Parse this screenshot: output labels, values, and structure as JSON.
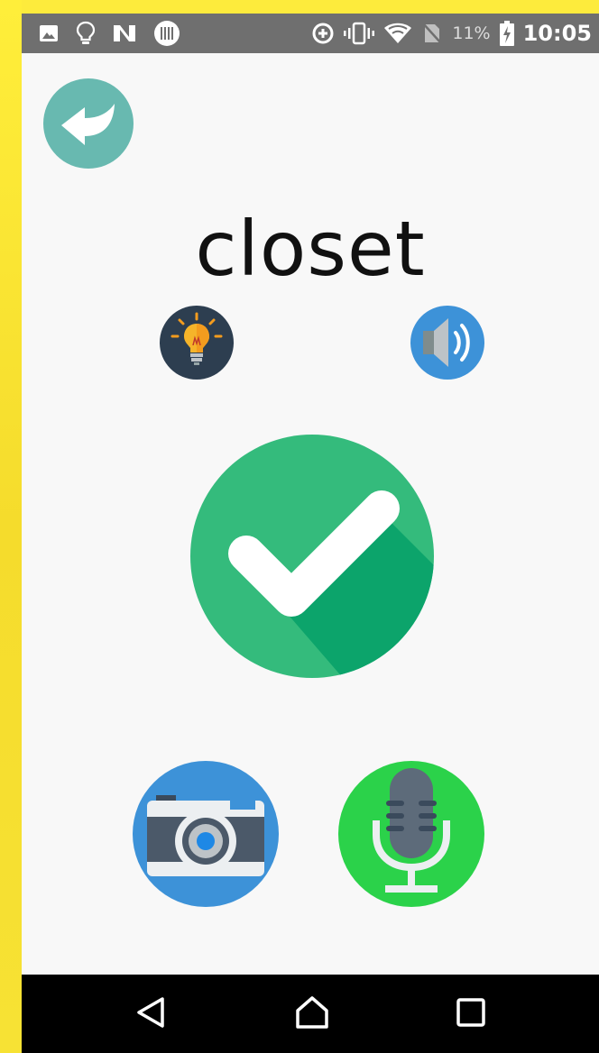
{
  "status_bar": {
    "battery_percent": "11%",
    "time": "10:05",
    "icons": [
      "image-icon",
      "lightbulb-outline-icon",
      "n-logo-icon",
      "barcode-icon",
      "data-saver-icon",
      "vibrate-icon",
      "wifi-icon",
      "no-sim-icon",
      "battery-charging-icon"
    ]
  },
  "main": {
    "word": "closet",
    "back_button_icon": "back-arrow-icon",
    "hint_button_icon": "lightbulb-icon",
    "speaker_button_icon": "speaker-icon",
    "check_button_icon": "checkmark-icon",
    "camera_button_icon": "camera-icon",
    "mic_button_icon": "microphone-icon"
  },
  "nav_bar": {
    "icons": [
      "back-triangle-icon",
      "home-icon",
      "recents-square-icon"
    ]
  },
  "colors": {
    "back_button": "#68b9b0",
    "hint_circle": "#2d3e50",
    "speaker_circle": "#3d92d8",
    "check_circle": "#34bb7c",
    "check_shadow": "#0ca46b",
    "camera_circle": "#3d92d8",
    "mic_circle": "#2bd24a",
    "status_bar": "#6f6f6f",
    "background": "#f8f8f8"
  }
}
